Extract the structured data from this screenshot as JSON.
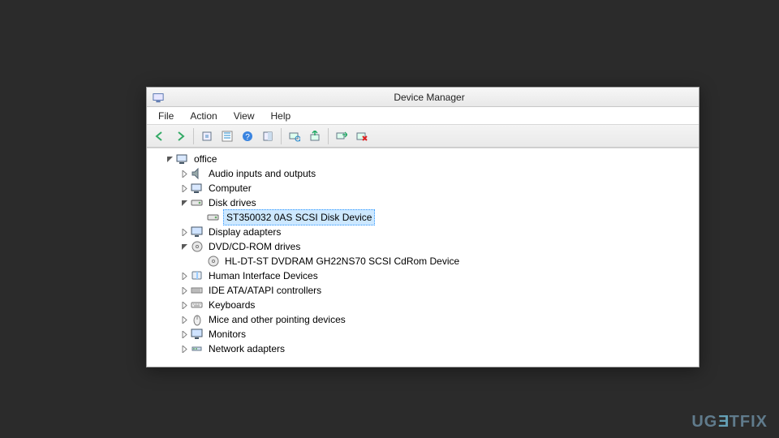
{
  "window": {
    "title": "Device Manager"
  },
  "menu": {
    "items": [
      "File",
      "Action",
      "View",
      "Help"
    ]
  },
  "toolbar": {
    "icons": [
      "back-icon",
      "forward-icon",
      "show-hidden-icon",
      "refresh-icon",
      "help-icon",
      "properties-icon",
      "scan-icon",
      "update-driver-icon",
      "enable-icon",
      "uninstall-icon"
    ]
  },
  "tree": {
    "root": "office",
    "nodes": [
      {
        "label": "Audio inputs and outputs",
        "icon": "audio-icon",
        "expanded": false,
        "children": []
      },
      {
        "label": "Computer",
        "icon": "computer-icon",
        "expanded": false,
        "children": []
      },
      {
        "label": "Disk drives",
        "icon": "disk-icon",
        "expanded": true,
        "children": [
          {
            "label": "ST350032 0AS SCSI Disk Device",
            "icon": "disk-icon",
            "selected": true
          }
        ]
      },
      {
        "label": "Display adapters",
        "icon": "display-icon",
        "expanded": false,
        "children": []
      },
      {
        "label": "DVD/CD-ROM drives",
        "icon": "dvd-icon",
        "expanded": true,
        "children": [
          {
            "label": "HL-DT-ST DVDRAM GH22NS70 SCSI CdRom Device",
            "icon": "dvd-icon"
          }
        ]
      },
      {
        "label": "Human Interface Devices",
        "icon": "hid-icon",
        "expanded": false,
        "children": []
      },
      {
        "label": "IDE ATA/ATAPI controllers",
        "icon": "ide-icon",
        "expanded": false,
        "children": []
      },
      {
        "label": "Keyboards",
        "icon": "keyboard-icon",
        "expanded": false,
        "children": []
      },
      {
        "label": "Mice and other pointing devices",
        "icon": "mouse-icon",
        "expanded": false,
        "children": []
      },
      {
        "label": "Monitors",
        "icon": "monitor-icon",
        "expanded": false,
        "children": []
      },
      {
        "label": "Network adapters",
        "icon": "network-icon",
        "expanded": false,
        "children": []
      }
    ]
  },
  "watermark": {
    "pre": "UG",
    "flip": "E",
    "post": "TFIX"
  }
}
